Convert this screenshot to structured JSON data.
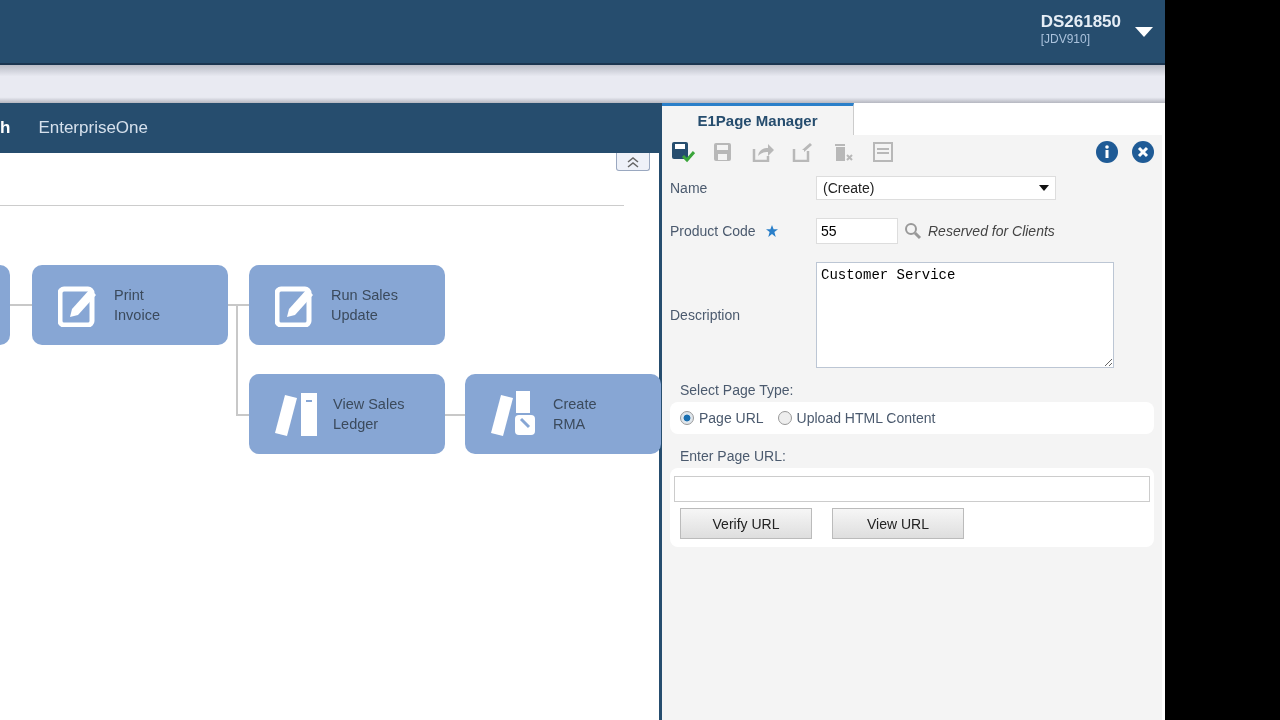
{
  "header": {
    "user": "DS261850",
    "environment": "[JDV910]"
  },
  "left_panel": {
    "tabs": [
      {
        "label": "h",
        "selected": true
      },
      {
        "label": "EnterpriseOne",
        "selected": false
      }
    ],
    "flow_nodes": [
      {
        "kind": "edge"
      },
      {
        "kind": "edit",
        "label": "Print Invoice"
      },
      {
        "kind": "edit",
        "label": "Run Sales Update"
      },
      {
        "kind": "ledger",
        "label": "View Sales Ledger"
      },
      {
        "kind": "ledger-tool",
        "label": "Create RMA"
      }
    ]
  },
  "page_manager": {
    "tab": "E1Page Manager",
    "toolbar": [
      {
        "kind": "save-check",
        "disabled": false
      },
      {
        "kind": "save",
        "disabled": true
      },
      {
        "kind": "export",
        "disabled": true
      },
      {
        "kind": "import",
        "disabled": true
      },
      {
        "kind": "delete",
        "disabled": true
      },
      {
        "kind": "print",
        "disabled": true
      }
    ],
    "name": {
      "label": "Name",
      "value": "(Create)"
    },
    "product_code": {
      "label": "Product Code",
      "value": "55",
      "hint": "Reserved for Clients"
    },
    "description": {
      "label": "Description",
      "value": "Customer Service"
    },
    "page_type": {
      "label": "Select Page Type:",
      "options": [
        {
          "label": "Page URL",
          "selected": true
        },
        {
          "label": "Upload HTML Content",
          "selected": false
        }
      ]
    },
    "page_url": {
      "label": "Enter Page URL:",
      "buttons": [
        "Verify URL",
        "View URL"
      ]
    }
  }
}
